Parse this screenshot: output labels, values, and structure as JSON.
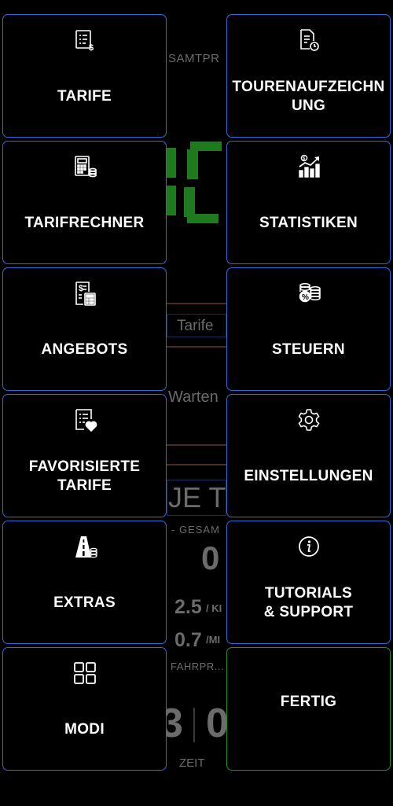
{
  "menu": {
    "tiles": [
      {
        "label": "TARIFE",
        "icon": "invoice-dollar-icon"
      },
      {
        "label": "TOURENAUFZEICHN\nUNG",
        "icon": "document-clock-icon"
      },
      {
        "label": "TARIFRECHNER",
        "icon": "calculator-coins-icon"
      },
      {
        "label": "STATISTIKEN",
        "icon": "chart-growth-icon"
      },
      {
        "label": "ANGEBOTS",
        "icon": "receipt-calculator-icon"
      },
      {
        "label": "STEUERN",
        "icon": "coins-percent-icon"
      },
      {
        "label": "FAVORISIERTE\nTARIFE",
        "icon": "document-heart-icon"
      },
      {
        "label": "EINSTELLUNGEN",
        "icon": "gear-icon"
      },
      {
        "label": "EXTRAS",
        "icon": "road-coins-icon"
      },
      {
        "label": "TUTORIALS\n& SUPPORT",
        "icon": "info-icon"
      },
      {
        "label": "MODI",
        "icon": "grid-icon"
      },
      {
        "label": "FERTIG",
        "icon": ""
      }
    ],
    "colors": {
      "border": "#3767d9",
      "done_border": "#2e8a2e"
    }
  },
  "background": {
    "total_price_label": "SAMTPR",
    "tariff_button": "Tarife",
    "waiting_label": "Warten",
    "new_tour_fragment": "JE T",
    "total_fragment": "- GESAM",
    "total_value": "0",
    "rate_km_value": "2.5",
    "rate_km_unit": "/ KI",
    "rate_mi_value": "0.7",
    "rate_mi_unit": "/MI",
    "fare_label": "FAHRPR...",
    "time_left": "3",
    "time_right": "0",
    "time_label": "ZEIT"
  }
}
